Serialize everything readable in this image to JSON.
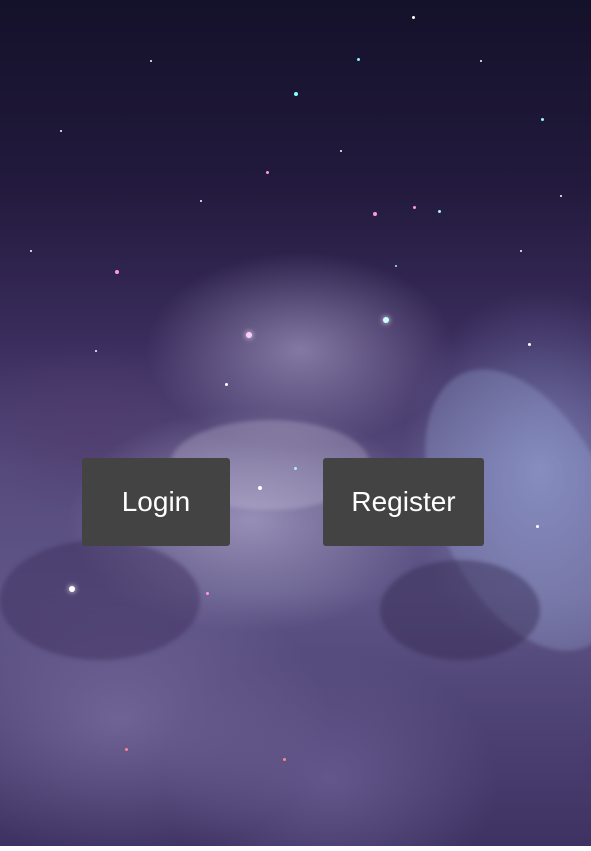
{
  "buttons": {
    "login_label": "Login",
    "register_label": "Register"
  },
  "colors": {
    "button_background": "#434343",
    "button_text": "#ffffff",
    "sky_top": "#14112a",
    "sky_mid": "#564a7c"
  }
}
